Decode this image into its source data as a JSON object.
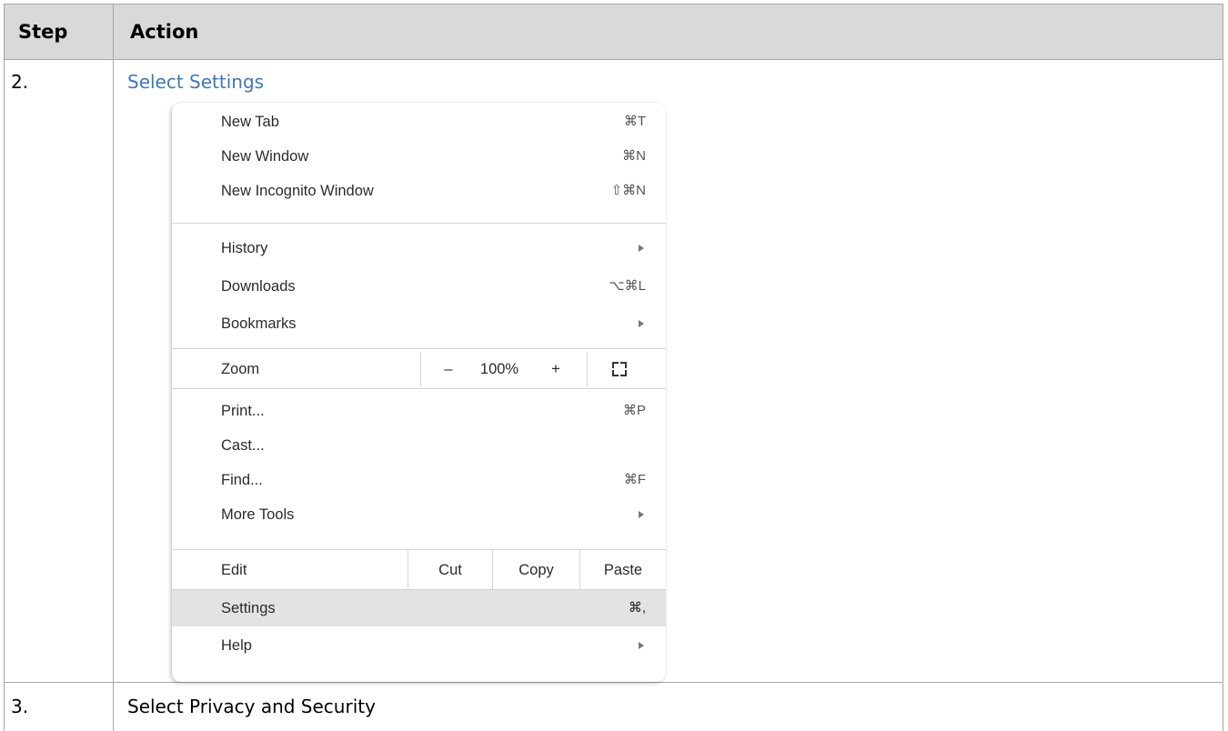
{
  "table": {
    "headers": {
      "step": "Step",
      "action": "Action"
    },
    "rows": [
      {
        "step": "2.",
        "action": "Select Settings"
      },
      {
        "step": "3.",
        "action": "Select Privacy and Security"
      }
    ]
  },
  "menu": {
    "items": {
      "new_tab": {
        "label": "New Tab",
        "shortcut": "⌘T"
      },
      "new_window": {
        "label": "New Window",
        "shortcut": "⌘N"
      },
      "new_incognito": {
        "label": "New Incognito Window",
        "shortcut": "⇧⌘N"
      },
      "history": {
        "label": "History"
      },
      "downloads": {
        "label": "Downloads",
        "shortcut": "⌥⌘L"
      },
      "bookmarks": {
        "label": "Bookmarks"
      },
      "print": {
        "label": "Print...",
        "shortcut": "⌘P"
      },
      "cast": {
        "label": "Cast..."
      },
      "find": {
        "label": "Find...",
        "shortcut": "⌘F"
      },
      "more_tools": {
        "label": "More Tools"
      },
      "settings": {
        "label": "Settings",
        "shortcut": "⌘,"
      },
      "help": {
        "label": "Help"
      }
    },
    "zoom": {
      "label": "Zoom",
      "minus": "–",
      "value": "100%",
      "plus": "+"
    },
    "edit": {
      "label": "Edit",
      "cut": "Cut",
      "copy": "Copy",
      "paste": "Paste"
    },
    "highlighted_item": "settings"
  },
  "colors": {
    "link": "#3e79b6",
    "header_bg": "#d9d9d9",
    "highlight": "#e3e3e3"
  }
}
